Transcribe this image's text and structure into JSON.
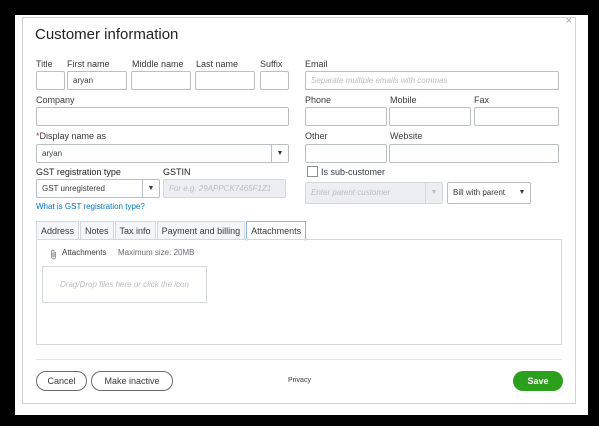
{
  "dialog": {
    "title": "Customer information",
    "close_icon": "×"
  },
  "name": {
    "title_label": "Title",
    "title_value": "",
    "first_label": "First name",
    "first_value": "aryan",
    "middle_label": "Middle name",
    "middle_value": "",
    "last_label": "Last name",
    "last_value": "",
    "suffix_label": "Suffix",
    "suffix_value": ""
  },
  "email": {
    "label": "Email",
    "placeholder": "Separate multiple emails with commas"
  },
  "company": {
    "label": "Company",
    "value": ""
  },
  "phone": {
    "phone_label": "Phone",
    "mobile_label": "Mobile",
    "fax_label": "Fax"
  },
  "display_name": {
    "required_mark": "*",
    "label": "Display name as",
    "value": "aryan"
  },
  "other": {
    "other_label": "Other",
    "website_label": "Website"
  },
  "gst": {
    "type_label": "GST registration type",
    "type_value": "GST unregistered",
    "gstin_label": "GSTIN",
    "gstin_placeholder": "For e.g. 29APPCK7465F1Z1",
    "help_link": "What is GST registration type?"
  },
  "sub_customer": {
    "checkbox_label": "Is sub-customer",
    "parent_placeholder": "Enter parent customer",
    "bill_with_value": "Bill with parent"
  },
  "tabs": [
    "Address",
    "Notes",
    "Tax info",
    "Payment and billing",
    "Attachments"
  ],
  "active_tab": "Attachments",
  "attachments": {
    "label": "Attachments",
    "max_size": "Maximum size: 20MB",
    "dropzone_text": "Drag/Drop files here or click the icon"
  },
  "footer": {
    "cancel": "Cancel",
    "make_inactive": "Make inactive",
    "privacy": "Privacy",
    "save": "Save"
  },
  "colors": {
    "save_button": "#2ca01c",
    "link": "#0077c5",
    "required": "#d52b1e"
  },
  "icons": {
    "paperclip": "paperclip-icon",
    "dropdown": "chevron-down-icon"
  }
}
